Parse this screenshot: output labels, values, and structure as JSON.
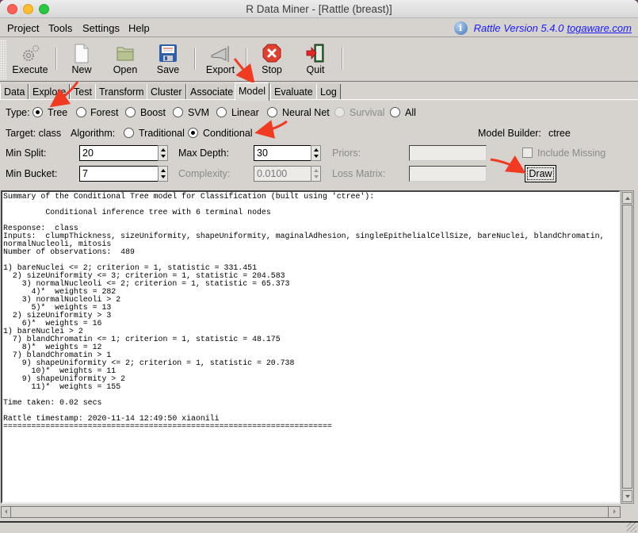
{
  "window": {
    "title": "R Data Miner - [Rattle (breast)]"
  },
  "menubar": {
    "items": [
      "Project",
      "Tools",
      "Settings",
      "Help"
    ],
    "version_text": "Rattle Version 5.4.0",
    "version_link": "togaware.com"
  },
  "toolbar": {
    "buttons": [
      {
        "label": "Execute",
        "icon": "gears-icon"
      },
      {
        "label": "New",
        "icon": "new-document-icon"
      },
      {
        "label": "Open",
        "icon": "folder-icon"
      },
      {
        "label": "Save",
        "icon": "floppy-disk-icon"
      },
      {
        "label": "Export",
        "icon": "export-icon"
      },
      {
        "label": "Stop",
        "icon": "stop-icon"
      },
      {
        "label": "Quit",
        "icon": "exit-door-icon"
      }
    ]
  },
  "tabs": {
    "items": [
      "Data",
      "Explore",
      "Test",
      "Transform",
      "Cluster",
      "Associate",
      "Model",
      "Evaluate",
      "Log"
    ],
    "active": "Model"
  },
  "model": {
    "type_label": "Type:",
    "types": [
      {
        "label": "Tree",
        "selected": true,
        "enabled": true
      },
      {
        "label": "Forest",
        "selected": false,
        "enabled": true
      },
      {
        "label": "Boost",
        "selected": false,
        "enabled": true
      },
      {
        "label": "SVM",
        "selected": false,
        "enabled": true
      },
      {
        "label": "Linear",
        "selected": false,
        "enabled": true
      },
      {
        "label": "Neural Net",
        "selected": false,
        "enabled": true
      },
      {
        "label": "Survival",
        "selected": false,
        "enabled": false
      },
      {
        "label": "All",
        "selected": false,
        "enabled": true
      }
    ],
    "target_text": "Target: class",
    "algorithm_label": "Algorithm:",
    "algorithms": [
      {
        "label": "Traditional",
        "selected": false
      },
      {
        "label": "Conditional",
        "selected": true
      }
    ],
    "model_builder_label": "Model Builder:",
    "model_builder_value": "ctree",
    "min_split_label": "Min Split:",
    "min_split_value": "20",
    "max_depth_label": "Max Depth:",
    "max_depth_value": "30",
    "priors_label": "Priors:",
    "priors_value": "",
    "include_missing_label": "Include Missing",
    "include_missing_checked": false,
    "min_bucket_label": "Min Bucket:",
    "min_bucket_value": "7",
    "complexity_label": "Complexity:",
    "complexity_value": "0.0100",
    "loss_matrix_label": "Loss Matrix:",
    "loss_matrix_value": "",
    "draw_label": "Draw"
  },
  "output": {
    "text": "Summary of the Conditional Tree model for Classification (built using 'ctree'):\n\n         Conditional inference tree with 6 terminal nodes\n\nResponse:  class\nInputs:  clumpThickness, sizeUniformity, shapeUniformity, maginalAdhesion, singleEpithelialCellSize, bareNuclei, blandChromatin,\nnormalNucleoli, mitosis\nNumber of observations:  489\n\n1) bareNuclei <= 2; criterion = 1, statistic = 331.451\n  2) sizeUniformity <= 3; criterion = 1, statistic = 204.583\n    3) normalNucleoli <= 2; criterion = 1, statistic = 65.373\n      4)*  weights = 282\n    3) normalNucleoli > 2\n      5)*  weights = 13\n  2) sizeUniformity > 3\n    6)*  weights = 16\n1) bareNuclei > 2\n  7) blandChromatin <= 1; criterion = 1, statistic = 48.175\n    8)*  weights = 12\n  7) blandChromatin > 1\n    9) shapeUniformity <= 2; criterion = 1, statistic = 20.738\n      10)*  weights = 11\n    9) shapeUniformity > 2\n      11)*  weights = 155\n\nTime taken: 0.02 secs\n\nRattle timestamp: 2020-11-14 12:49:50 xiaonili\n======================================================================"
  },
  "colors": {
    "annotation_arrow": "#f03a22",
    "link": "#1a1aff"
  }
}
